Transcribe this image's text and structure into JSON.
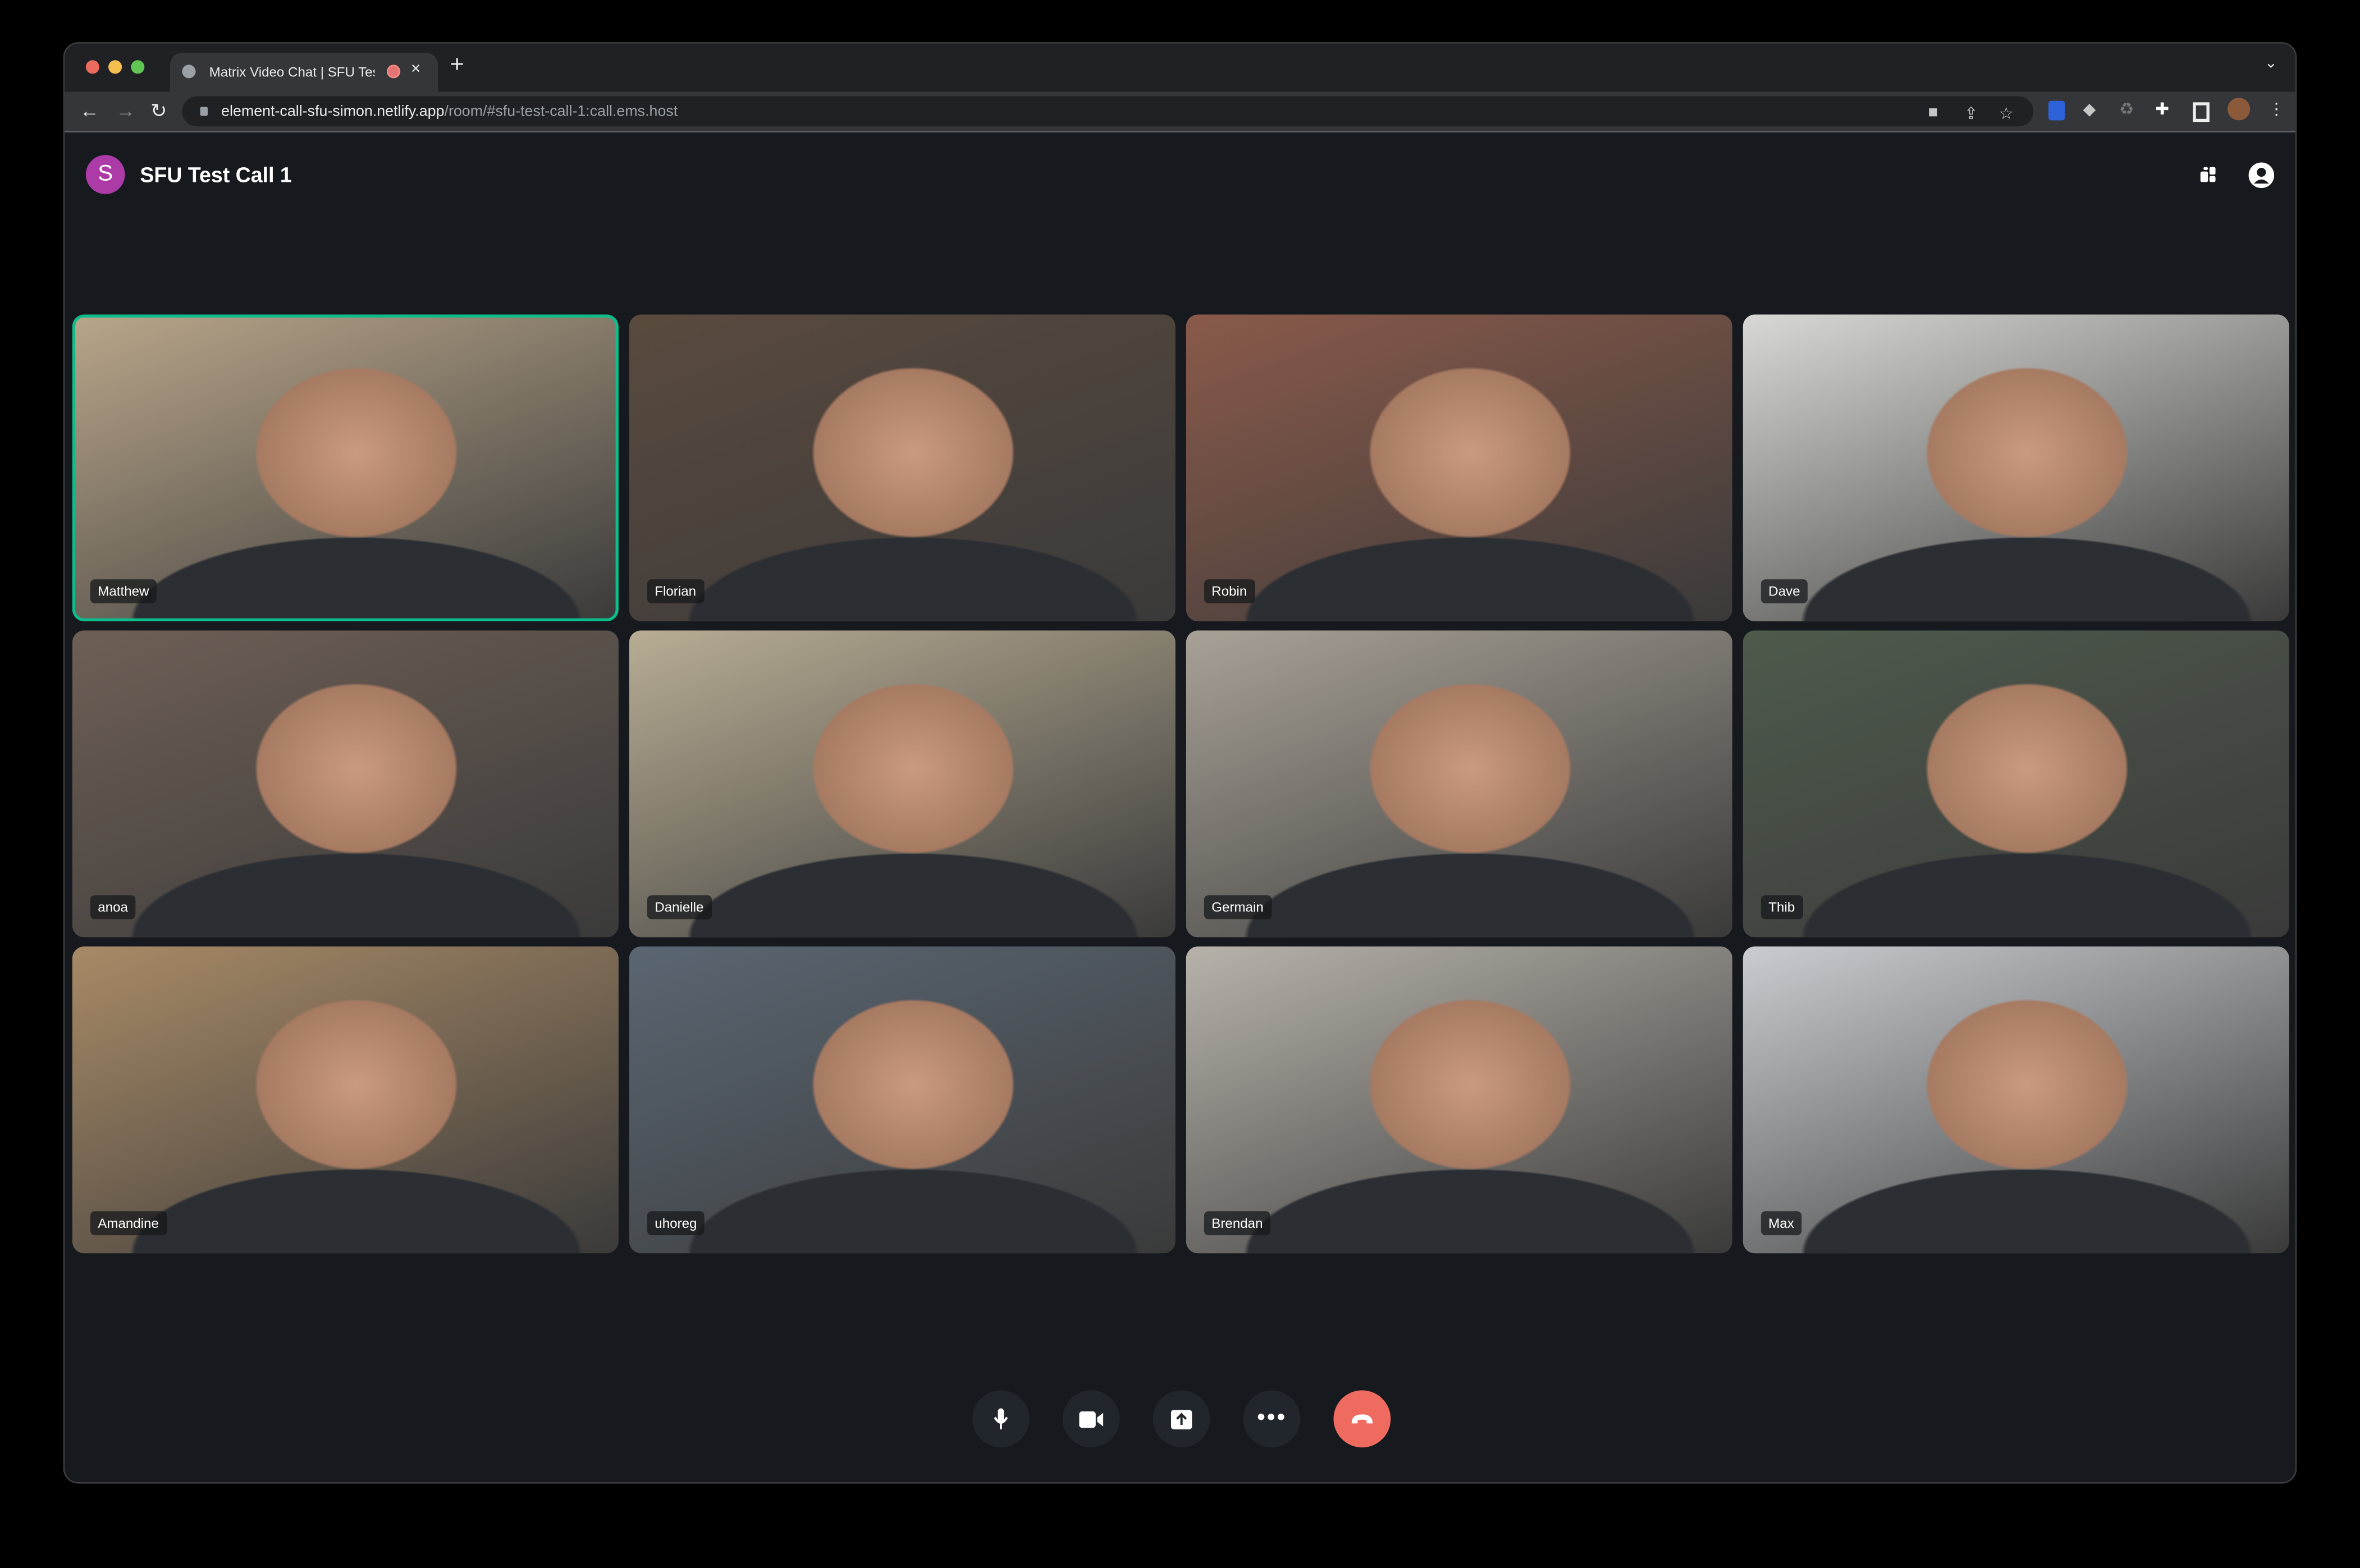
{
  "browser": {
    "tab_title": "Matrix Video Chat | SFU Test Call 1",
    "url_host": "element-call-sfu-simon.netlify.app",
    "url_path": "/room/#sfu-test-call-1:call.ems.host",
    "toolbar_icons": [
      "camera-icon",
      "share-icon",
      "star-icon",
      "bitwarden-icon",
      "extension-arrow-icon",
      "recycle-icon",
      "puzzle-icon",
      "sidepanel-icon",
      "profile-avatar",
      "more-icon"
    ]
  },
  "header": {
    "avatar_letter": "S",
    "room_name": "SFU Test Call 1",
    "icons": [
      "grid-layout-icon",
      "user-menu-icon"
    ]
  },
  "participants": [
    {
      "name": "Matthew",
      "speaking": true,
      "tone": "#b9a68a"
    },
    {
      "name": "Florian",
      "speaking": false,
      "tone": "#5a4a3e"
    },
    {
      "name": "Robin",
      "speaking": false,
      "tone": "#8a5a4a"
    },
    {
      "name": "Dave",
      "speaking": false,
      "tone": "#d8d8d4"
    },
    {
      "name": "anoa",
      "speaking": false,
      "tone": "#6e5f55"
    },
    {
      "name": "Danielle",
      "speaking": false,
      "tone": "#b8ad94"
    },
    {
      "name": "Germain",
      "speaking": false,
      "tone": "#a8a196"
    },
    {
      "name": "Thib",
      "speaking": false,
      "tone": "#4e5a4c"
    },
    {
      "name": "Amandine",
      "speaking": false,
      "tone": "#a88a66"
    },
    {
      "name": "uhoreg",
      "speaking": false,
      "tone": "#5a6672"
    },
    {
      "name": "Brendan",
      "speaking": false,
      "tone": "#b7b2aa"
    },
    {
      "name": "Max",
      "speaking": false,
      "tone": "#c9ccd0"
    }
  ],
  "controls": [
    "microphone",
    "camera",
    "screenshare",
    "more",
    "hangup"
  ],
  "colors": {
    "speaking_border": "#0dbd8b",
    "hangup": "#ef6a5f",
    "avatar": "#ac3ba8"
  }
}
